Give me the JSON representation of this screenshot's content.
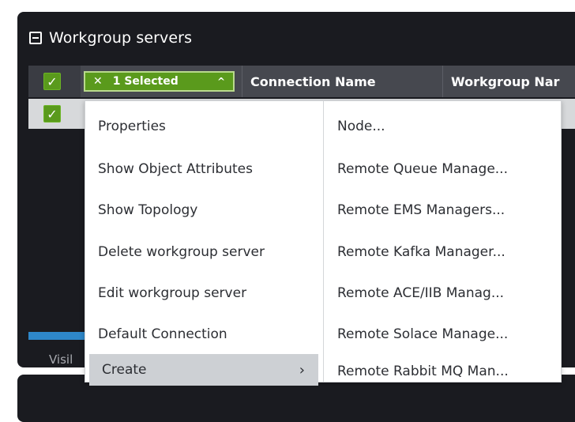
{
  "panel": {
    "title": "Workgroup servers"
  },
  "table": {
    "selected_label": "1 Selected",
    "columns": [
      "Connection Name",
      "Workgroup Nar"
    ]
  },
  "footer": {
    "visible_label": "Visil"
  },
  "context_menu": {
    "left_items": [
      "Properties",
      "Show Object Attributes",
      "Show Topology",
      "Delete workgroup server",
      "Edit workgroup server",
      "Default Connection",
      "Create"
    ],
    "right_items": [
      "Node...",
      "Remote Queue Manage...",
      "Remote EMS Managers...",
      "Remote Kafka Manager...",
      "Remote ACE/IIB Manag...",
      "Remote Solace Manage...",
      "Remote Rabbit MQ Man..."
    ]
  },
  "icons": {
    "collapse": "collapse-square-icon",
    "check": "check-icon",
    "clear": "close-icon",
    "caret": "chevron-up-icon",
    "submenu": "chevron-right-icon"
  },
  "colors": {
    "accent_green": "#5a9a1c",
    "panel_bg": "#1a1b20",
    "header_bg": "#46484f",
    "menu_active": "#cdd0d4",
    "progress_blue": "#2e87c9"
  }
}
